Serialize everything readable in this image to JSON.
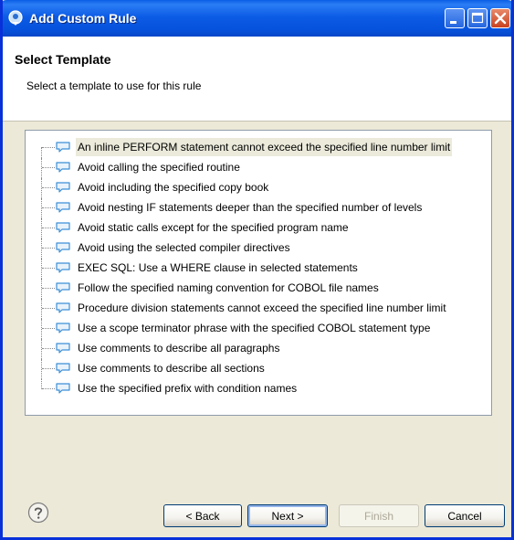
{
  "window": {
    "title": "Add Custom Rule"
  },
  "header": {
    "title": "Select Template",
    "description": "Select a template to use for this rule"
  },
  "templates": [
    "An inline PERFORM statement cannot exceed the specified line number limit",
    "Avoid calling the specified routine",
    "Avoid including the specified copy book",
    "Avoid nesting IF statements deeper than the specified number of levels",
    "Avoid static calls except for the specified program name",
    "Avoid using the selected compiler directives",
    "EXEC SQL: Use a WHERE clause in selected statements",
    "Follow the specified naming convention for COBOL file names",
    "Procedure division statements cannot exceed the specified line number limit",
    "Use a scope terminator phrase with the specified COBOL statement type",
    "Use comments to describe all paragraphs",
    "Use comments to describe all sections",
    "Use the specified prefix with condition names"
  ],
  "selected_index": 0,
  "buttons": {
    "back": "< Back",
    "next": "Next >",
    "finish": "Finish",
    "cancel": "Cancel"
  },
  "colors": {
    "titlebar": "#0a5ee4",
    "dialog_background": "#ece9d8",
    "selection": "#ebeadb",
    "template_icon": "#3c8fd6"
  },
  "icons": {
    "app": "rule-wizard-icon",
    "template": "speech-bubble-icon",
    "help": "help-icon"
  }
}
